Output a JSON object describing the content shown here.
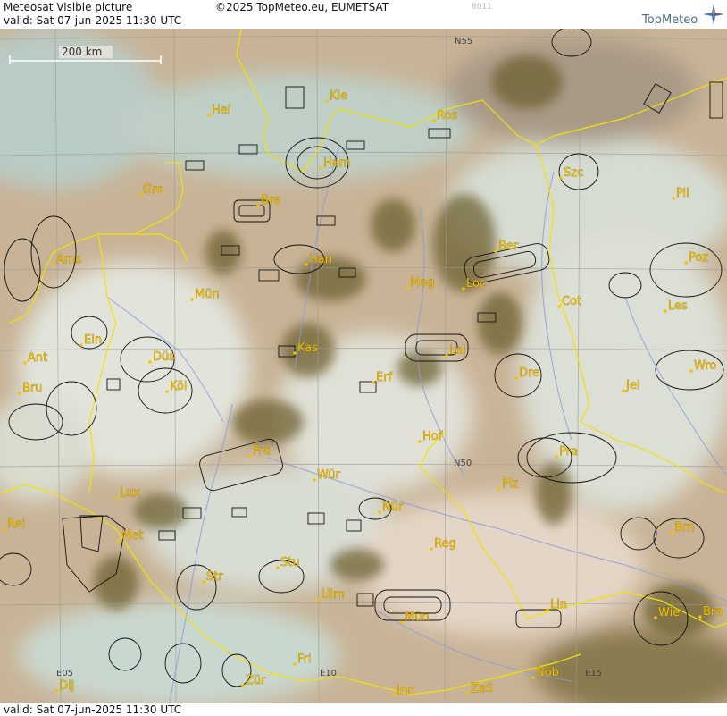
{
  "header": {
    "title": "Meteosat Visible picture",
    "copyright": "©2025 TopMeteo.eu, EUMETSAT",
    "code": "8011",
    "valid": "valid:  Sat  07-jun-2025  11:30 UTC",
    "brand": "TopMeteo"
  },
  "footer": {
    "valid": "valid:  Sat  07-jun-2025  11:30 UTC"
  },
  "scale": {
    "label": "200 km"
  },
  "grid_labels": [
    "N55",
    "N50",
    "E05",
    "E10",
    "E15"
  ],
  "cities": [
    {
      "name": "Hel"
    },
    {
      "name": "Kie"
    },
    {
      "name": "Ros"
    },
    {
      "name": "Ham"
    },
    {
      "name": "Szc"
    },
    {
      "name": "Gro"
    },
    {
      "name": "Bre"
    },
    {
      "name": "Pil"
    },
    {
      "name": "Ber"
    },
    {
      "name": "Ams"
    },
    {
      "name": "Han"
    },
    {
      "name": "Poz"
    },
    {
      "name": "Mün"
    },
    {
      "name": "Mag"
    },
    {
      "name": "Loc"
    },
    {
      "name": "Cot"
    },
    {
      "name": "Les"
    },
    {
      "name": "Ein"
    },
    {
      "name": "Ant"
    },
    {
      "name": "Düs"
    },
    {
      "name": "Kas"
    },
    {
      "name": "Lei"
    },
    {
      "name": "Bru"
    },
    {
      "name": "Köl"
    },
    {
      "name": "Erf"
    },
    {
      "name": "Dre"
    },
    {
      "name": "Wro"
    },
    {
      "name": "Jel"
    },
    {
      "name": "Hof"
    },
    {
      "name": "Fra"
    },
    {
      "name": "Pra"
    },
    {
      "name": "Wür"
    },
    {
      "name": "Plz"
    },
    {
      "name": "Lux"
    },
    {
      "name": "Nür"
    },
    {
      "name": "Rei"
    },
    {
      "name": "Met"
    },
    {
      "name": "Reg"
    },
    {
      "name": "Brn"
    },
    {
      "name": "Stu"
    },
    {
      "name": "Str"
    },
    {
      "name": "Ulm"
    },
    {
      "name": "Lin"
    },
    {
      "name": "Mün"
    },
    {
      "name": "Wie"
    },
    {
      "name": "Bra"
    },
    {
      "name": "Fri"
    },
    {
      "name": "Dij"
    },
    {
      "name": "Zür"
    },
    {
      "name": "Inn"
    },
    {
      "name": "ZaS"
    },
    {
      "name": "Nöb"
    }
  ],
  "colors": {
    "land": "#c9b59a",
    "cloud": "#dfe6de",
    "forest": "#6f6434",
    "border": "#f2e300",
    "river": "#8a9bd8",
    "city_label": "#f2c200",
    "airspace": "#111111"
  }
}
